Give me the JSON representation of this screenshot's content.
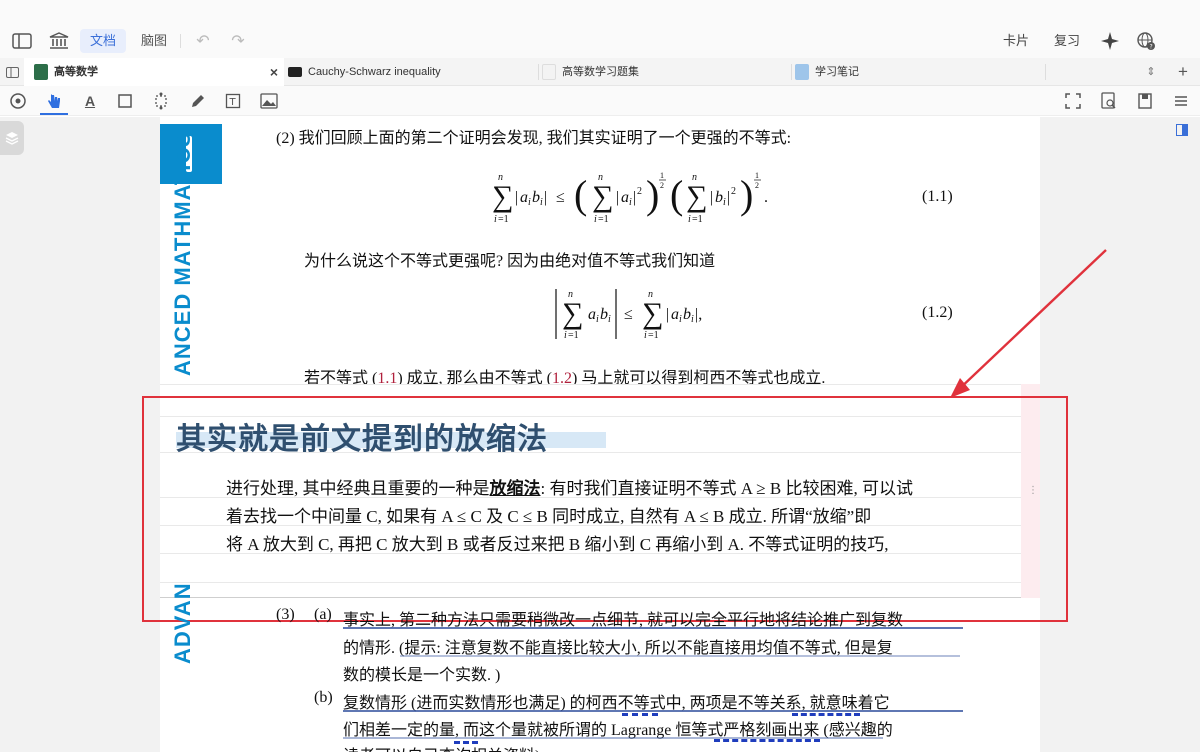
{
  "toolbar": {
    "doc_tab": "文档",
    "mindmap_tab": "脑图",
    "card_label": "卡片",
    "review_label": "复习"
  },
  "tabs": [
    {
      "label": "高等数学",
      "active": true
    },
    {
      "label": "Cauchy-Schwarz inequality"
    },
    {
      "label": "高等数学习题集"
    },
    {
      "label": "学习笔记"
    }
  ],
  "tab_close": "×",
  "book": {
    "spine_top": "ANCED MATHMATICS",
    "spine_bottom": "ADVAN"
  },
  "content": {
    "para1": "(2) 我们回顾上面的第二个证明会发现, 我们其实证明了一个更强的不等式:",
    "eq1_no": "(1.1)",
    "para2": "为什么说这个不等式更强呢? 因为由绝对值不等式我们知道",
    "eq2_no": "(1.2)",
    "para3_a": "若不等式 (",
    "para3_ref1": "1.1",
    "para3_b": ") 成立, 那么由不等式 (",
    "para3_ref2": "1.2",
    "para3_c": ") 马上就可以得到柯西不等式也成立.",
    "item3_num": "(3)",
    "item3a_label": "(a)",
    "item3a_l1": "事实上, 第二种方法只需要稍微改一点细节, 就可以完全平行地将结论推广到复数",
    "item3a_l2": "的情形. (提示: 注意复数不能直接比较大小, 所以不能直接用均值不等式, 但是复",
    "item3a_l3": "数的模长是一个实数. )",
    "item3b_label": "(b)",
    "item3b_l1": "复数情形 (进而实数情形也满足) 的柯西不等式中, 两项是不等关系, 就意味着它",
    "item3b_l2": "们相差一定的量, 而这个量就被所谓的 Lagrange 恒等式严格刻画出来 (感兴趣的",
    "item3b_l3": "读者可以自己查询相关资料)"
  },
  "note": {
    "title": "其实就是前文提到的放缩法",
    "l1_a": "进行处理, 其中经典且重要的一种是",
    "l1_bold": "放缩法",
    "l1_b": ": 有时我们直接证明不等式 A ≥ B 比较困难, 可以试",
    "l2": "着去找一个中间量 C, 如果有 A ≤ C 及 C ≤ B 同时成立, 自然有 A ≤ B 成立. 所谓“放缩”即",
    "l3": "将 A 放大到 C, 再把 C 放大到 B 或者反过来把 B 缩小到 C 再缩小到 A. 不等式证明的技巧,"
  },
  "icons": [
    "sidebar-toggle-icon",
    "library-icon",
    "undo-icon",
    "redo-icon",
    "ai-sparkle-icon",
    "language-help-icon",
    "tab-list-icon",
    "add-tab-icon",
    "hand-icon",
    "text-icon",
    "rect-icon",
    "pen-icon",
    "image-icon",
    "fullscreen-icon",
    "search-doc-icon",
    "bookmark-icon",
    "more-icon"
  ],
  "colors": {
    "accent": "#2f6fe0",
    "annotation_red": "#e0323c",
    "spine_blue": "#0a8ccd",
    "ref_red": "#b0203c"
  }
}
